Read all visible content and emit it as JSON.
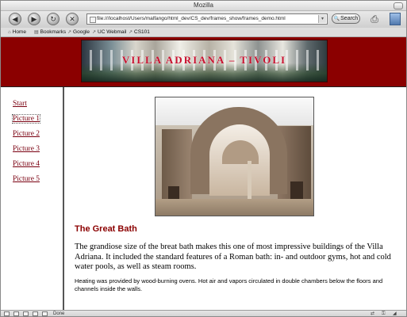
{
  "window": {
    "title": "Mozilla"
  },
  "toolbar": {
    "url": "file:///localhost/Users/malfango/html_dev/CS_dev/frames_show/frames_demo.html",
    "search_label": "Search"
  },
  "bookmarks": [
    {
      "label": "Home",
      "icon": "home-icon"
    },
    {
      "label": "Bookmarks",
      "icon": "bookmarks-icon"
    },
    {
      "label": "Google",
      "icon": "bookmark-link-icon"
    },
    {
      "label": "UC Webmail",
      "icon": "bookmark-link-icon"
    },
    {
      "label": "CS101",
      "icon": "bookmark-link-icon"
    }
  ],
  "banner": {
    "title": "VILLA ADRIANA – TIVOLI",
    "background_color": "#8b0000"
  },
  "nav": {
    "links": [
      "Start",
      "Picture 1",
      "Picture 2",
      "Picture 3",
      "Picture 4",
      "Picture 5"
    ],
    "active_index": 1,
    "link_color": "#7a0010"
  },
  "content": {
    "heading": "The Great Bath",
    "heading_color": "#8b0000",
    "paragraph1": "The grandiose size of the breat bath makes this one of most impressive buildings of the Villa Adriana. It included the standard features of a Roman bath: in- and outdoor gyms, hot and cold water pools, as well as steam rooms.",
    "paragraph2": "Heating was provided by wood-burning ovens. Hot air and vapors circulated in double chambers below the floors and channels inside the walls."
  },
  "statusbar": {
    "status_text": "Done"
  }
}
